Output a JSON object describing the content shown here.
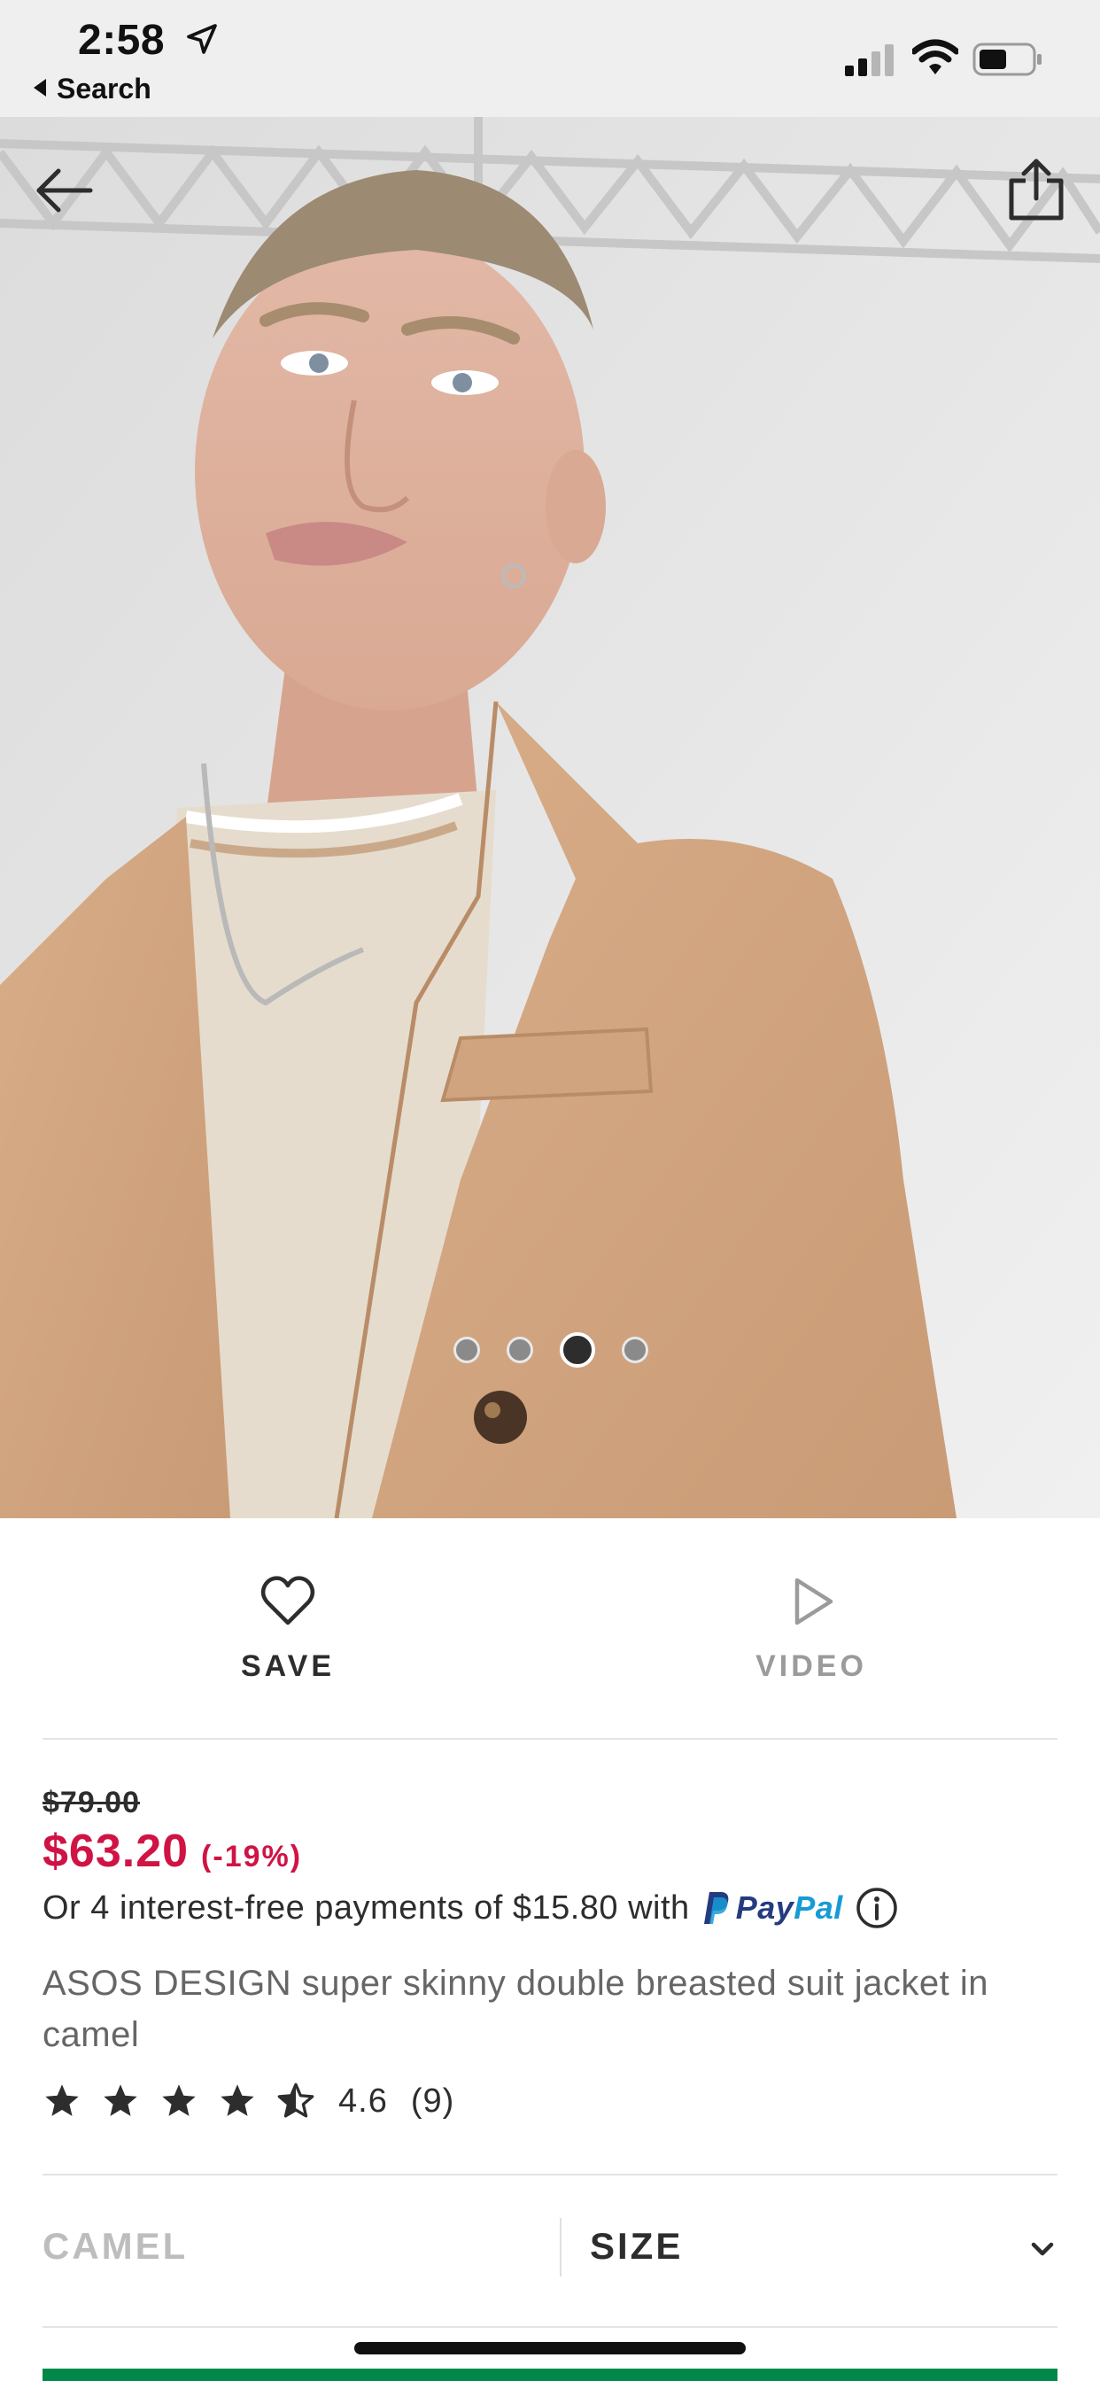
{
  "status_bar": {
    "time": "2:58",
    "back_app_label": "Search",
    "icons": [
      "location-arrow-icon",
      "cellular-signal-icon",
      "wifi-icon",
      "battery-icon"
    ]
  },
  "gallery": {
    "icons": [
      "back-arrow-icon",
      "share-icon"
    ],
    "image_count": 4,
    "active_index": 2
  },
  "actions": {
    "save_label": "SAVE",
    "video_label": "VIDEO",
    "icons": [
      "heart-icon",
      "play-icon"
    ]
  },
  "pricing": {
    "was_price": "$79.00",
    "now_price": "$63.20",
    "discount": "(-19%)",
    "installments_text": "Or 4 interest-free payments of $15.80 with",
    "paypal_pay": "Pay",
    "paypal_pal": "Pal",
    "price_color": "#d01345"
  },
  "product": {
    "title": "ASOS DESIGN super skinny double breasted suit jacket in camel",
    "rating_value": "4.6",
    "rating_count": "(9)",
    "stars": 4.5
  },
  "selectors": {
    "colour_label": "CAMEL",
    "size_label": "SIZE"
  },
  "colors": {
    "accent_green": "#018849",
    "text_dark": "#2d2d2d",
    "text_muted": "#9b9b9b"
  }
}
